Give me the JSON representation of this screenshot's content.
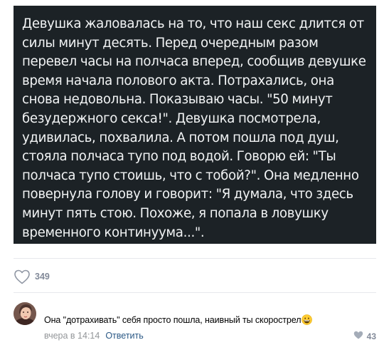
{
  "post": {
    "story": "Девушка жаловалась на то, что наш секс длится от силы минут десять. Перед очередным разом перевел часы на полчаса вперед, сообщив девушке время начала полового акта. Потрахались, она снова недовольна. Показываю часы. \"50 минут безудержного секса!\". Девушка посмотрела, удивилась, похвалила. А потом пошла под душ, стояла полчаса тупо под водой. Говорю ей: \"Ты полчаса тупо стоишь, что с тобой?\". Она медленно повернула голову и говорит: \"Я думала, что здесь минут пять стою. Похоже, я попала в ловушку временного континуума...\".",
    "likes": "349",
    "icons": {
      "like": "heart-outline-icon"
    }
  },
  "comment": {
    "text": "Она \"дотрахивать\" себя просто пошла, наивный ты скорострел",
    "emoji": "grinning-face-icon",
    "time": "вчера в 14:14",
    "reply_label": "Ответить",
    "likes": "43",
    "icons": {
      "like": "heart-filled-icon",
      "avatar": "user-avatar"
    }
  },
  "colors": {
    "image_bg": "#1c2226",
    "link": "#2a5885",
    "muted": "#939699",
    "icon": "#828a99"
  }
}
